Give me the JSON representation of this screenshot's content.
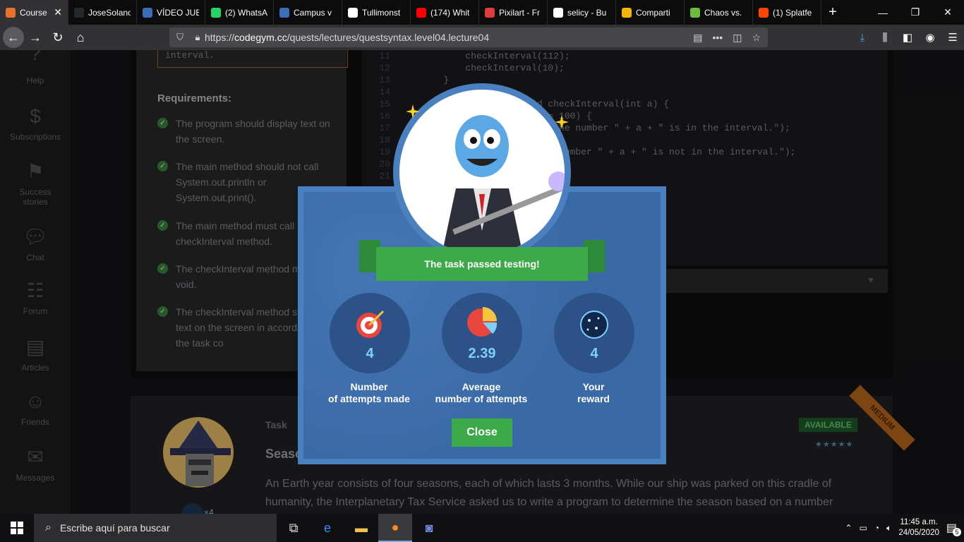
{
  "browser": {
    "tabs": [
      {
        "label": "Course",
        "color": "#e8722a",
        "active": true
      },
      {
        "label": "JoseSolano",
        "color": "#24292e"
      },
      {
        "label": "VÍDEO JUE",
        "color": "#3b6fb5"
      },
      {
        "label": "(2) WhatsA",
        "color": "#25d366"
      },
      {
        "label": "Campus v",
        "color": "#3b6fb5"
      },
      {
        "label": "Tullimonst",
        "color": "#ffffff"
      },
      {
        "label": "(174) Whit",
        "color": "#ff0000"
      },
      {
        "label": "Pixilart - Fr",
        "color": "#e23b3b"
      },
      {
        "label": "selicy - Bu",
        "color": "#ffffff"
      },
      {
        "label": "Comparti",
        "color": "#f4b400"
      },
      {
        "label": "Chaos vs.",
        "color": "#6dbb3a"
      },
      {
        "label": "(1) Splatfe",
        "color": "#ff4500"
      }
    ],
    "url_prefix": "https://",
    "url_host": "codegym.cc",
    "url_path": "/quests/lectures/questsyntax.level04.lecture04",
    "url_menu": "•••"
  },
  "sidebar": [
    {
      "label": "Help",
      "icon": "help-icon"
    },
    {
      "label": "Subscriptions",
      "icon": "subscriptions-icon"
    },
    {
      "label": "Success\nstories",
      "icon": "flag-icon"
    },
    {
      "label": "Chat",
      "icon": "chat-icon"
    },
    {
      "label": "Forum",
      "icon": "forum-icon"
    },
    {
      "label": "Articles",
      "icon": "articles-icon"
    },
    {
      "label": "Friends",
      "icon": "friends-icon"
    },
    {
      "label": "Messages",
      "icon": "messages-icon"
    }
  ],
  "task": {
    "condition_tail": "interval.",
    "requirements_title": "Requirements:",
    "requirements": [
      "The program should display text on the screen.",
      "The main method should not call System.out.println or System.out.print().",
      "The main method must call checkInterval method.",
      "The checkInterval method m static void.",
      "The checkInterval method st display text on the screen in accordance with the task co"
    ]
  },
  "code": [
    {
      "n": "11",
      "t": "        checkInterval(112);"
    },
    {
      "n": "12",
      "t": "        checkInterval(10);"
    },
    {
      "n": "13",
      "t": "    }"
    },
    {
      "n": "14",
      "t": ""
    },
    {
      "n": "15",
      "t": "    public s      void checkInterval(int a) {"
    },
    {
      "n": "16",
      "t": "        if (   0 && a <= 100) {"
    },
    {
      "n": "17",
      "t": "              .println(\"The number \" + a + \" is in the interval.\");"
    },
    {
      "n": "18",
      "t": ""
    },
    {
      "n": "19",
      "t": "                 ln(\"The number \" + a + \" is not in the interval.\");"
    },
    {
      "n": "20",
      "t": ""
    },
    {
      "n": "21",
      "t": ""
    }
  ],
  "modal": {
    "banner": "The task passed testing!",
    "stats": [
      {
        "value": "4",
        "label": "Number\nof attempts made",
        "icon": "target-icon"
      },
      {
        "value": "2.39",
        "label": "Average\nnumber of attempts",
        "icon": "pie-icon"
      },
      {
        "value": "4",
        "label": "Your\nreward",
        "icon": "dark-matter-icon"
      }
    ],
    "close_label": "Close"
  },
  "next_task": {
    "label": "Task",
    "title": "Seaso",
    "status": "AVAILABLE",
    "difficulty": "MEDIUM",
    "stars": "★★★★★",
    "reward_badge": "×4",
    "description": "An Earth year consists of four seasons, each of which lasts 3 months. While our ship was parked on this cradle of humanity, the Interplanetary Tax Service asked us to write a program to determine the season based on a number"
  },
  "taskbar": {
    "search_placeholder": "Escribe aquí para buscar",
    "time": "11:45 a.m.",
    "date": "24/05/2020",
    "notifications": "5"
  }
}
